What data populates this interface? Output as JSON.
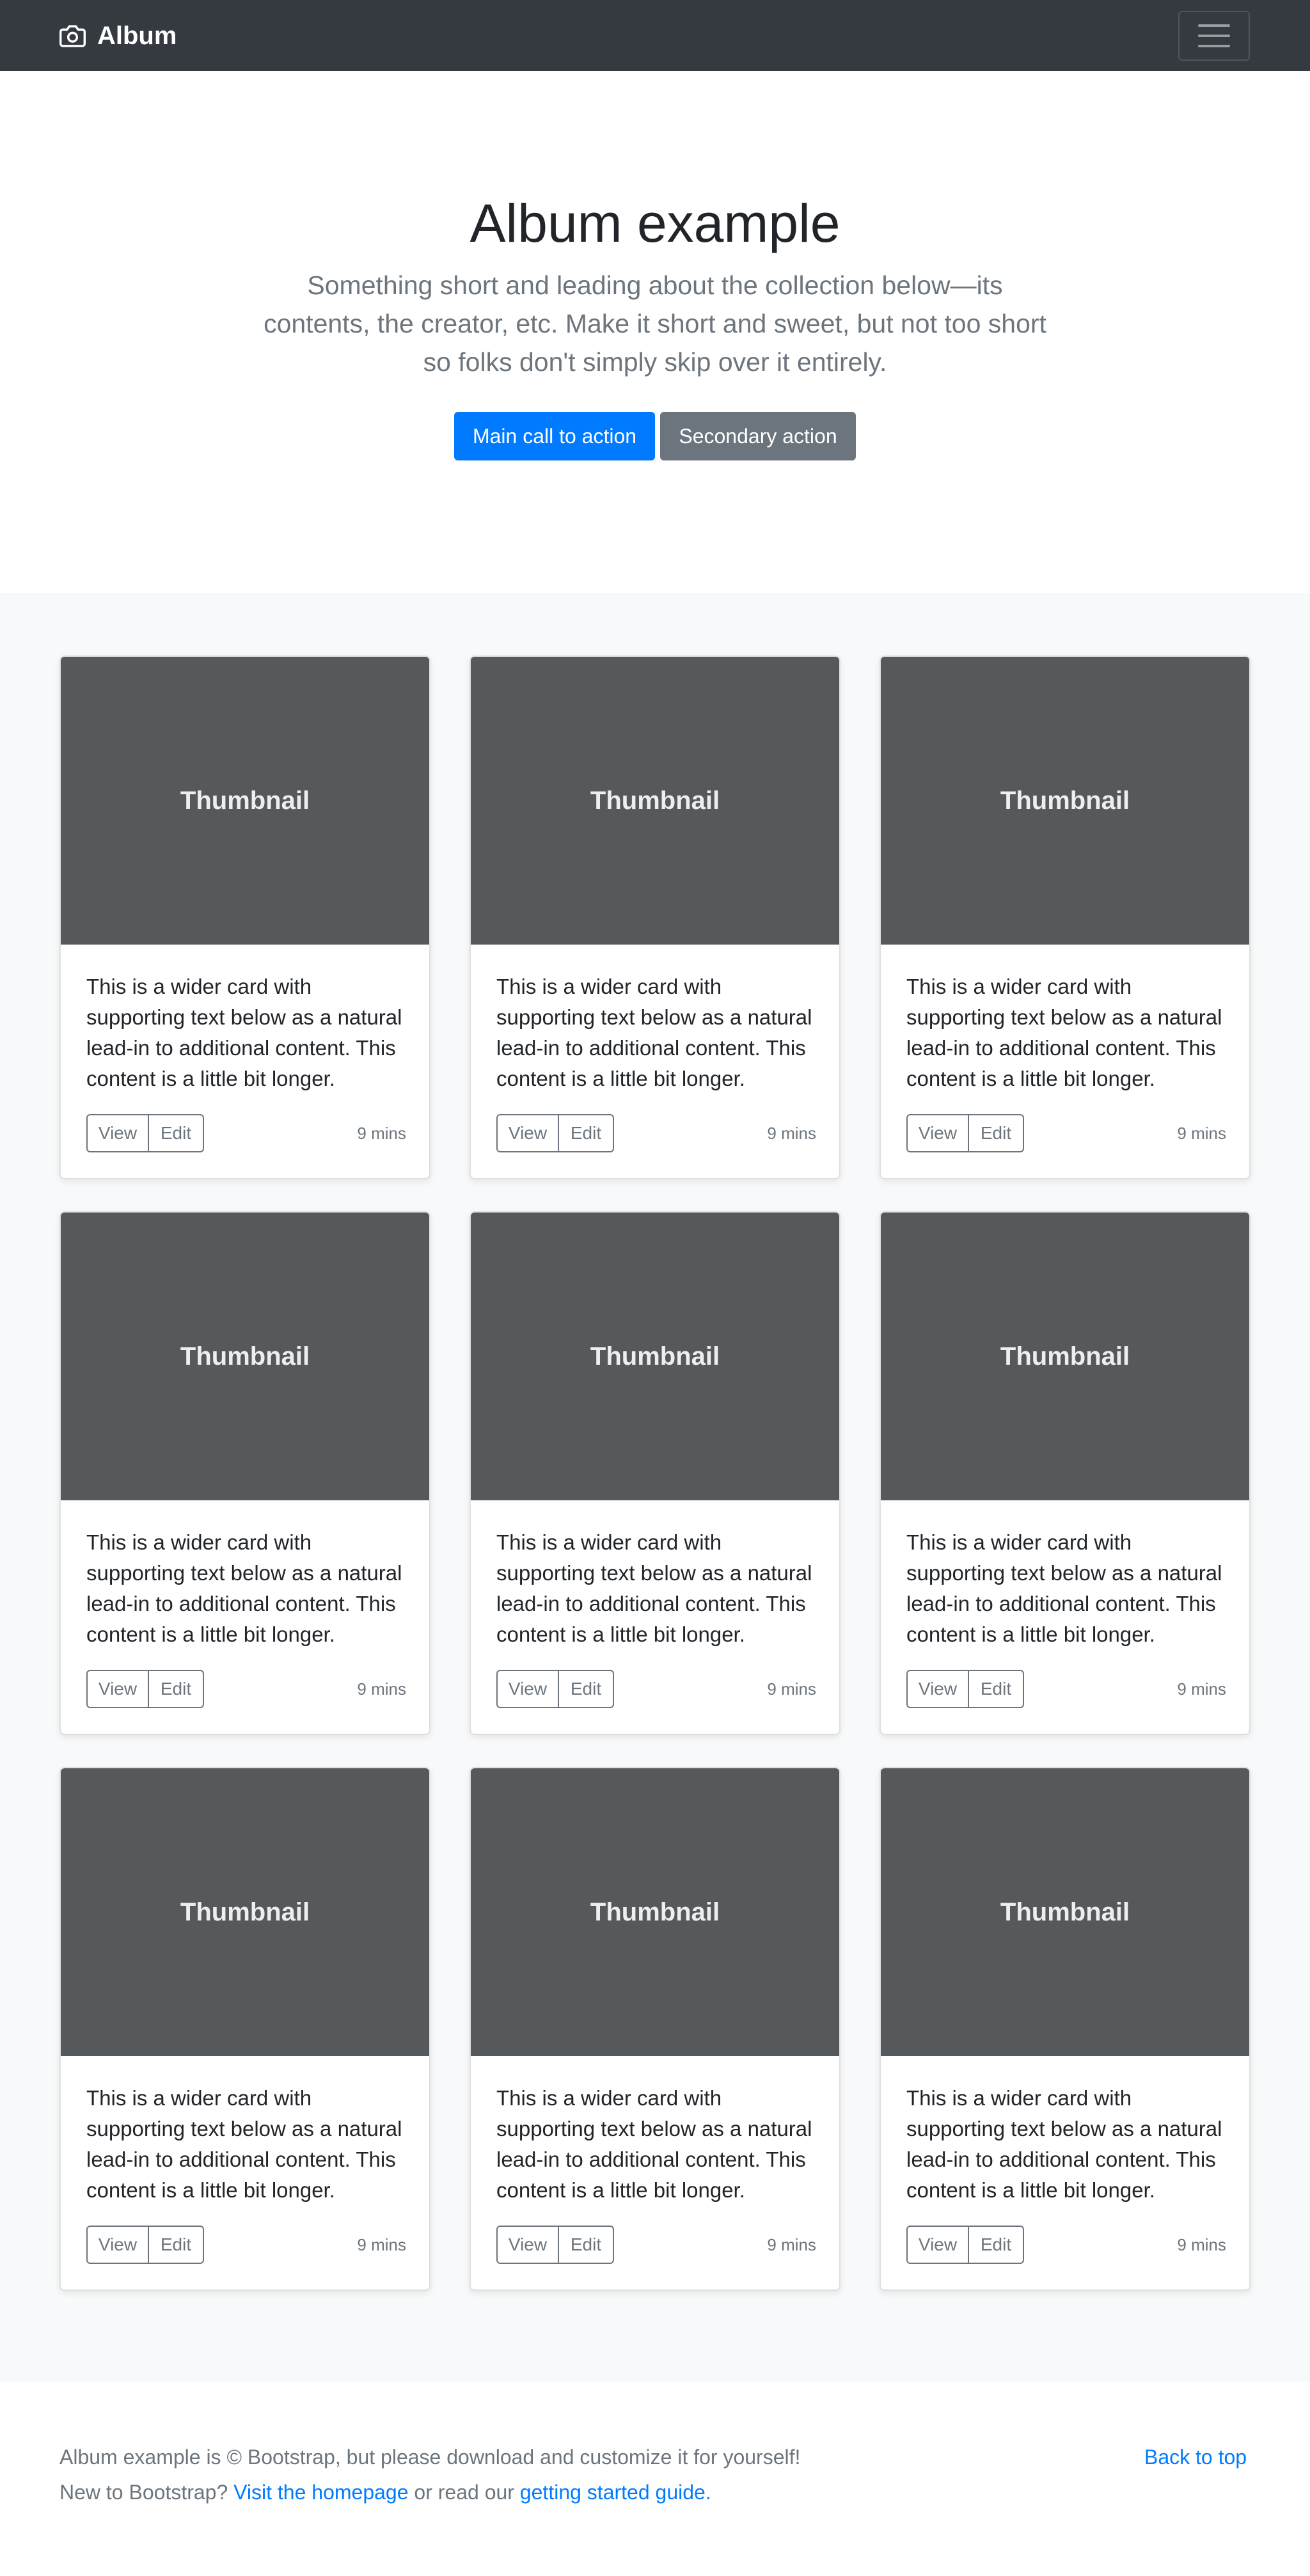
{
  "header": {
    "brand": "Album",
    "brand_icon": "camera-icon",
    "menu_icon": "hamburger-icon"
  },
  "hero": {
    "title": "Album example",
    "lead": "Something short and leading about the collection below—its contents, the creator, etc. Make it short and sweet, but not too short so folks don't simply skip over it entirely.",
    "primary_button": "Main call to action",
    "secondary_button": "Secondary action"
  },
  "cards": [
    {
      "thumbnail": "Thumbnail",
      "text": "This is a wider card with supporting text below as a natural lead-in to additional content. This content is a little bit longer.",
      "view": "View",
      "edit": "Edit",
      "time": "9 mins"
    },
    {
      "thumbnail": "Thumbnail",
      "text": "This is a wider card with supporting text below as a natural lead-in to additional content. This content is a little bit longer.",
      "view": "View",
      "edit": "Edit",
      "time": "9 mins"
    },
    {
      "thumbnail": "Thumbnail",
      "text": "This is a wider card with supporting text below as a natural lead-in to additional content. This content is a little bit longer.",
      "view": "View",
      "edit": "Edit",
      "time": "9 mins"
    },
    {
      "thumbnail": "Thumbnail",
      "text": "This is a wider card with supporting text below as a natural lead-in to additional content. This content is a little bit longer.",
      "view": "View",
      "edit": "Edit",
      "time": "9 mins"
    },
    {
      "thumbnail": "Thumbnail",
      "text": "This is a wider card with supporting text below as a natural lead-in to additional content. This content is a little bit longer.",
      "view": "View",
      "edit": "Edit",
      "time": "9 mins"
    },
    {
      "thumbnail": "Thumbnail",
      "text": "This is a wider card with supporting text below as a natural lead-in to additional content. This content is a little bit longer.",
      "view": "View",
      "edit": "Edit",
      "time": "9 mins"
    },
    {
      "thumbnail": "Thumbnail",
      "text": "This is a wider card with supporting text below as a natural lead-in to additional content. This content is a little bit longer.",
      "view": "View",
      "edit": "Edit",
      "time": "9 mins"
    },
    {
      "thumbnail": "Thumbnail",
      "text": "This is a wider card with supporting text below as a natural lead-in to additional content. This content is a little bit longer.",
      "view": "View",
      "edit": "Edit",
      "time": "9 mins"
    },
    {
      "thumbnail": "Thumbnail",
      "text": "This is a wider card with supporting text below as a natural lead-in to additional content. This content is a little bit longer.",
      "view": "View",
      "edit": "Edit",
      "time": "9 mins"
    }
  ],
  "footer": {
    "line1": "Album example is © Bootstrap, but please download and customize it for yourself!",
    "line2_prefix": "New to Bootstrap? ",
    "homepage_link": "Visit the homepage",
    "line2_middle": " or read our ",
    "guide_link": "getting started guide.",
    "back_to_top": "Back to top"
  },
  "colors": {
    "navbar": "#343a40",
    "primary": "#007bff",
    "secondary": "#6c757d",
    "thumbnail": "#55595c",
    "album_bg": "#f8f9fa"
  }
}
